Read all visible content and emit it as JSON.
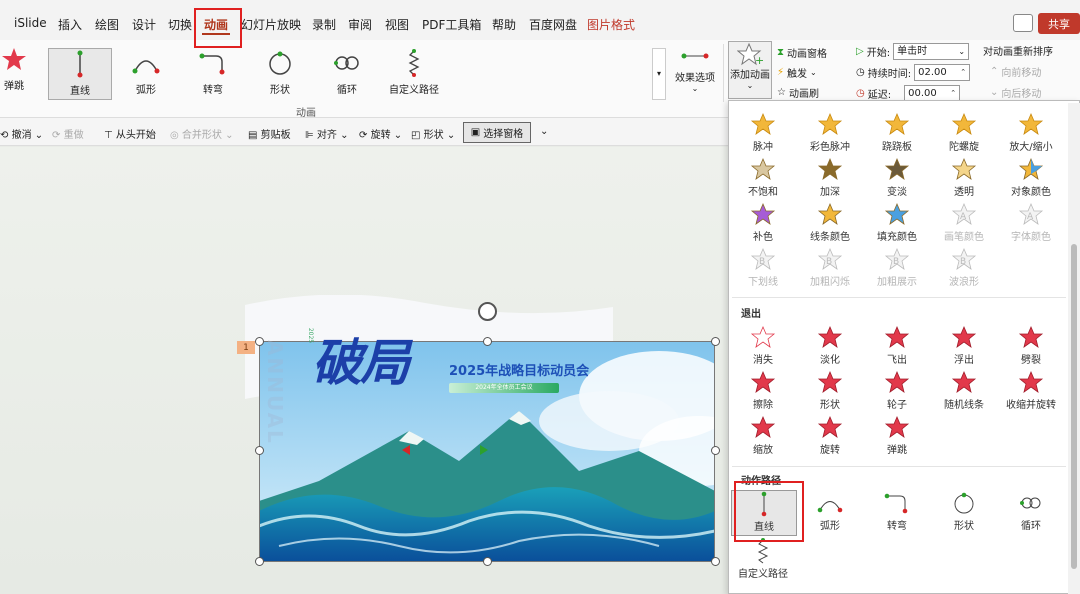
{
  "menu": {
    "tabs": [
      "iSlide",
      "插入",
      "绘图",
      "设计",
      "切换",
      "动画",
      "幻灯片放映",
      "录制",
      "审阅",
      "视图",
      "PDF工具箱",
      "帮助",
      "百度网盘",
      "图片格式"
    ],
    "active_tab": "动画",
    "share_label": "共享"
  },
  "ribbon": {
    "animations": [
      "弹跳",
      "直线",
      "弧形",
      "转弯",
      "形状",
      "循环",
      "自定义路径"
    ],
    "selected_animation": "直线",
    "group_label": "动画",
    "effect_options": "效果选项",
    "add_animation": "添加动画",
    "animation_pane": "动画窗格",
    "trigger": "触发",
    "animation_painter": "动画刷",
    "start_label": "开始:",
    "start_value": "单击时",
    "duration_label": "持续时间:",
    "duration_value": "02.00",
    "delay_label": "延迟:",
    "delay_value": "00.00",
    "reorder_label": "对动画重新排序",
    "move_earlier": "向前移动",
    "move_later": "向后移动"
  },
  "toolbar": {
    "undo": "撤消",
    "redo": "重做",
    "from_start": "从头开始",
    "merge_shapes": "合并形状",
    "clipboard": "剪贴板",
    "align": "对齐",
    "rotate": "旋转",
    "shape": "形状",
    "selection_pane": "选择窗格"
  },
  "slide": {
    "anim_number": "1",
    "title_big": "破局",
    "title": "2025年战略目标动员会",
    "subtitle": "2024年全体员工会议",
    "year_tag": "2025",
    "watermark": "ANNUAL"
  },
  "panel": {
    "emphasis_row1": [
      "脉冲",
      "彩色脉冲",
      "跷跷板",
      "陀螺旋",
      "放大/缩小"
    ],
    "emphasis_row2": [
      "不饱和",
      "加深",
      "变淡",
      "透明",
      "对象颜色"
    ],
    "emphasis_row3": [
      "补色",
      "线条颜色",
      "填充颜色",
      "画笔颜色",
      "字体颜色"
    ],
    "emphasis_row4": [
      "下划线",
      "加粗闪烁",
      "加粗展示",
      "波浪形"
    ],
    "exit_heading": "退出",
    "exit_row1": [
      "消失",
      "淡化",
      "飞出",
      "浮出",
      "劈裂"
    ],
    "exit_row2": [
      "擦除",
      "形状",
      "轮子",
      "随机线条",
      "收缩并旋转"
    ],
    "exit_row3": [
      "缩放",
      "旋转",
      "弹跳"
    ],
    "path_heading": "动作路径",
    "path_row1": [
      "直线",
      "弧形",
      "转弯",
      "形状",
      "循环"
    ],
    "path_row2": [
      "自定义路径"
    ],
    "selected_path": "直线"
  },
  "colors": {
    "accent": "#b0371c",
    "highlight_box": "#e02020",
    "star_gold": "#f2b73a",
    "star_red": "#e2394b",
    "share_bg": "#c0392b"
  }
}
